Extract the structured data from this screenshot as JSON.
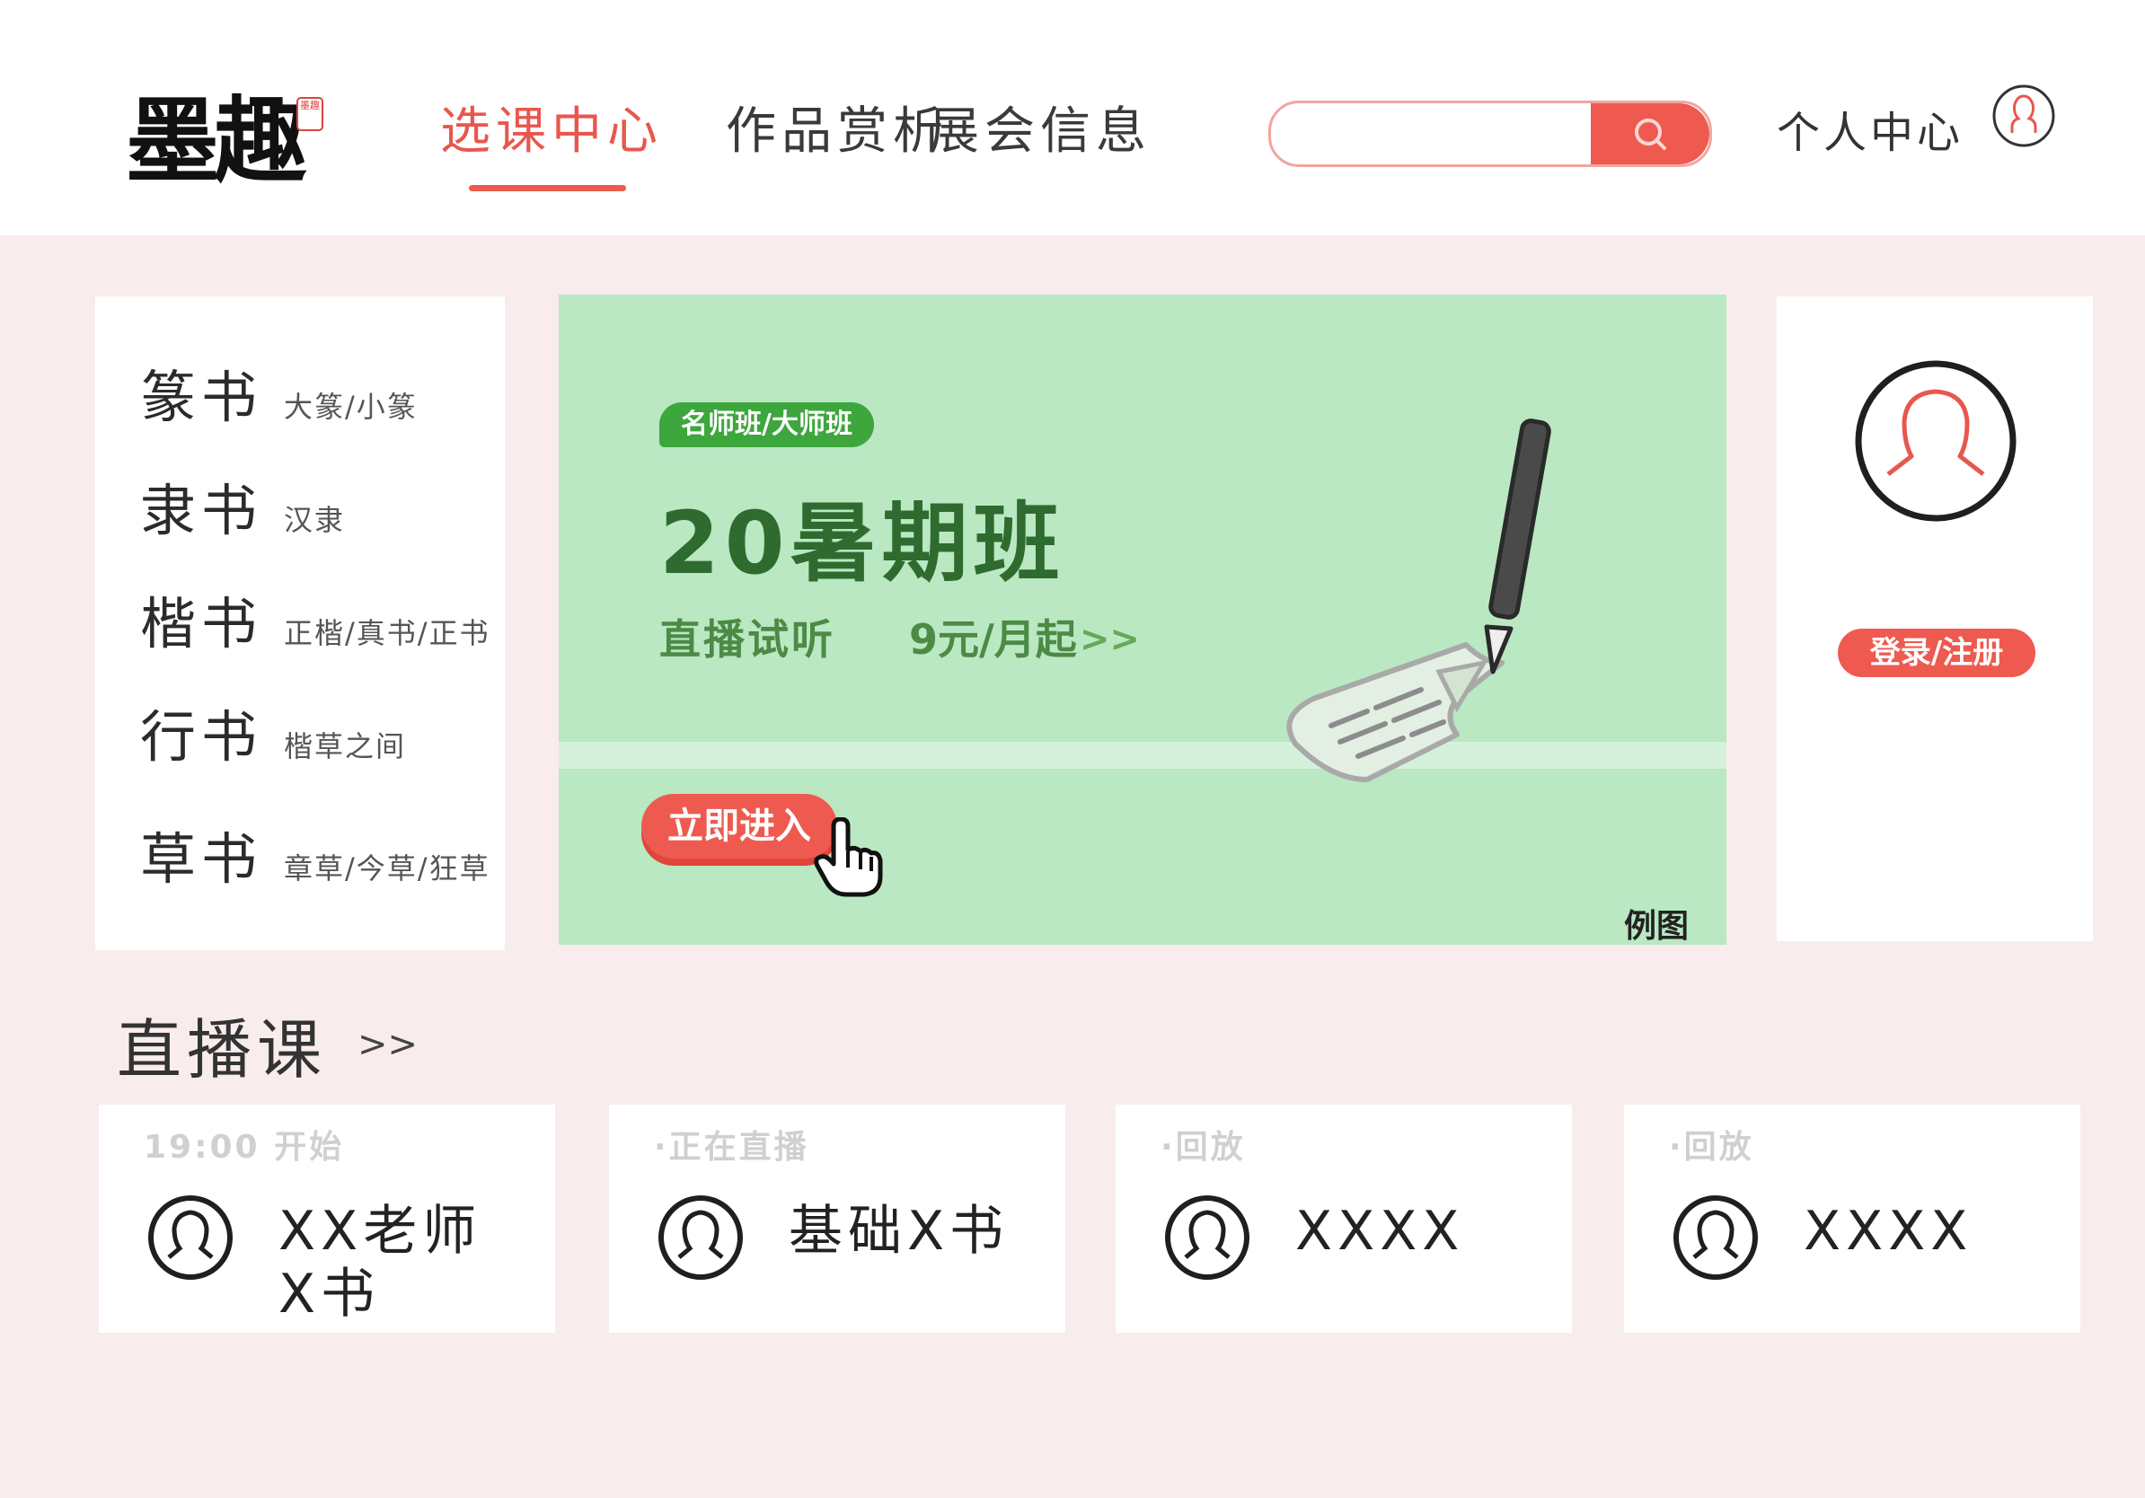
{
  "header": {
    "logo_text": "墨趣",
    "logo_seal": "墨趣",
    "nav": [
      {
        "label": "选课中心",
        "active": true
      },
      {
        "label": "作品赏析",
        "active": false
      },
      {
        "label": "展会信息",
        "active": false
      }
    ],
    "search": {
      "placeholder": "",
      "icon": "search-icon"
    },
    "personal_center": "个人中心",
    "avatar_icon": "user-icon"
  },
  "categories": [
    {
      "name": "篆书",
      "sub": "大篆/小篆"
    },
    {
      "name": "隶书",
      "sub": "汉隶"
    },
    {
      "name": "楷书",
      "sub": "正楷/真书/正书"
    },
    {
      "name": "行书",
      "sub": "楷草之间"
    },
    {
      "name": "草书",
      "sub": "章草/今草/狂草"
    }
  ],
  "banner": {
    "tag": "名师班/大师班",
    "title": "20暑期班",
    "subtitle": "直播试听",
    "price": "9元/月起",
    "arrow": ">>",
    "button": "立即进入",
    "sample_label": "例图",
    "background_color": "#b9e8c2"
  },
  "login": {
    "avatar_icon": "user-icon",
    "button": "登录/注册"
  },
  "live": {
    "title": "直播课",
    "more": ">>",
    "cards": [
      {
        "status": "19:00 开始",
        "name": "XX老师X书"
      },
      {
        "status": "·正在直播",
        "name": "基础X书"
      },
      {
        "status": "·回放",
        "name": "XXXX"
      },
      {
        "status": "·回放",
        "name": "XXXX"
      }
    ]
  },
  "colors": {
    "accent": "#ee5a50",
    "page_bg": "#f9ecec",
    "banner_green": "#b9e8c2",
    "tag_green": "#3da63d"
  }
}
